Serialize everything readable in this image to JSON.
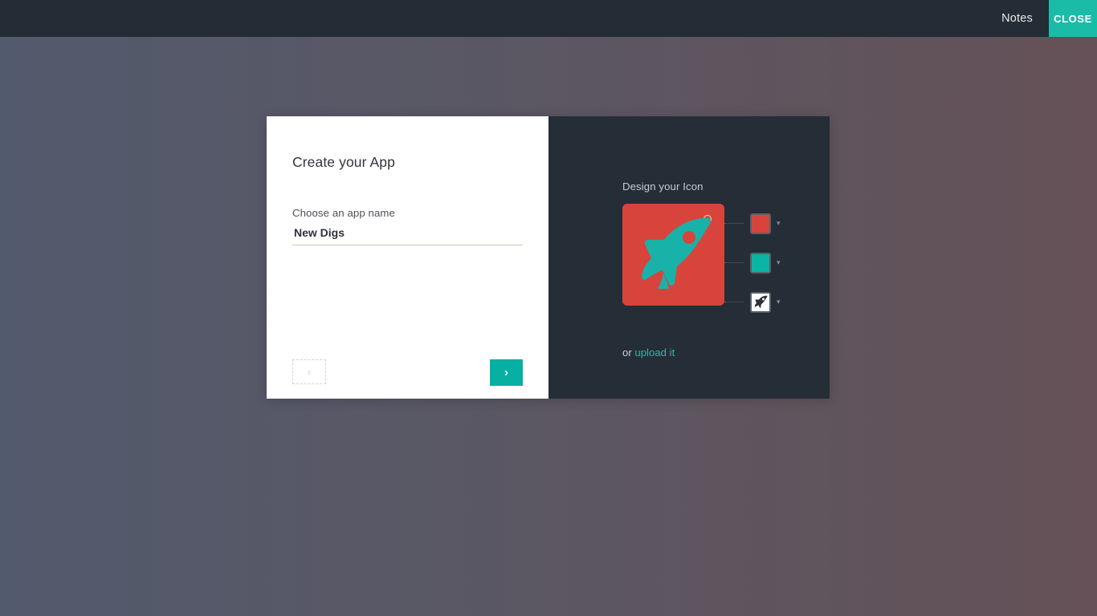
{
  "topbar": {
    "notes_label": "Notes",
    "close_label": "CLOSE",
    "bg_color": "#242c35",
    "close_bg_color": "#1abca7"
  },
  "background": {
    "gradient_from": "#525a6d",
    "gradient_to": "#655157"
  },
  "modal": {
    "left_pane": {
      "title": "Create your App",
      "field_label": "Choose an app name",
      "field_value": "New Digs",
      "field_placeholder": "Choose an app name",
      "back_button_label": "‹",
      "next_button_label": "›",
      "next_button_color": "#06b1a3"
    },
    "right_pane": {
      "heading": "Design your Icon",
      "bg_color": "#252d36",
      "canvas_color": "#d8443c",
      "rocket_color": "#18b2a8",
      "swatches": [
        {
          "name": "background-color-swatch",
          "color": "#d8443c",
          "chevron": "▾"
        },
        {
          "name": "foreground-color-swatch",
          "color": "#0ab5a5",
          "chevron": "▾"
        },
        {
          "name": "glyph-swatch",
          "color": "#ffffff",
          "glyph": "rocket-icon",
          "chevron": "▾"
        }
      ],
      "upload_prefix": "or ",
      "upload_link": "upload it"
    }
  }
}
